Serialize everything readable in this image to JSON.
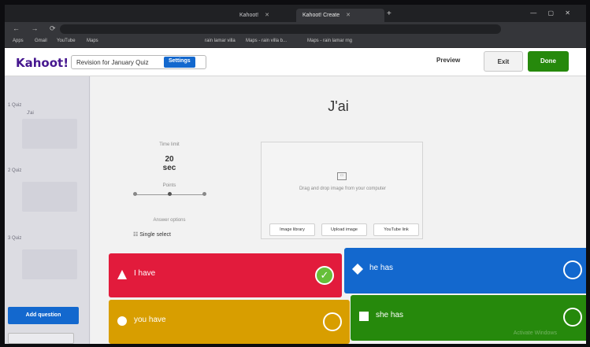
{
  "browser": {
    "tabs": [
      {
        "label": "Kahoot!",
        "active": false
      },
      {
        "label": "Kahoot! Create",
        "active": true
      }
    ],
    "new_tab": "+",
    "window_controls": "— ▢ ✕",
    "nav_buttons": "← → ⟳",
    "bookmarks": [
      "Apps",
      "Gmail",
      "YouTube",
      "Maps",
      "rain lamar villa",
      "Maps - rain villa b...",
      "Maps - rain lamar rng"
    ]
  },
  "header": {
    "logo": "Kahoot!",
    "quiz_name": "Revision for January Quiz",
    "settings": "Settings",
    "preview": "Preview",
    "exit": "Exit",
    "done": "Done"
  },
  "sidebar": {
    "items": [
      {
        "label": "1 Quiz",
        "sub": "J'ai"
      },
      {
        "label": "2 Quiz",
        "sub": ""
      },
      {
        "label": "3 Quiz",
        "sub": ""
      }
    ],
    "add_question": "Add question"
  },
  "question": {
    "title": "J'ai",
    "time_limit_label": "Time limit",
    "time_value": "20",
    "time_unit": "sec",
    "points_label": "Points",
    "answer_options_label": "Answer options",
    "single_select": "Single select",
    "media_hint": "Drag and drop image from your computer",
    "media_buttons": [
      "Image library",
      "Upload image",
      "YouTube link"
    ]
  },
  "answers": [
    {
      "text": "I have",
      "color": "#e21b3c",
      "shape": "triangle",
      "correct": true
    },
    {
      "text": "he has",
      "color": "#1368ce",
      "shape": "diamond",
      "correct": false
    },
    {
      "text": "you have",
      "color": "#d89e00",
      "shape": "circle",
      "correct": false
    },
    {
      "text": "she has",
      "color": "#26890c",
      "shape": "square",
      "correct": false
    }
  ],
  "watermark": "Activate Windows"
}
